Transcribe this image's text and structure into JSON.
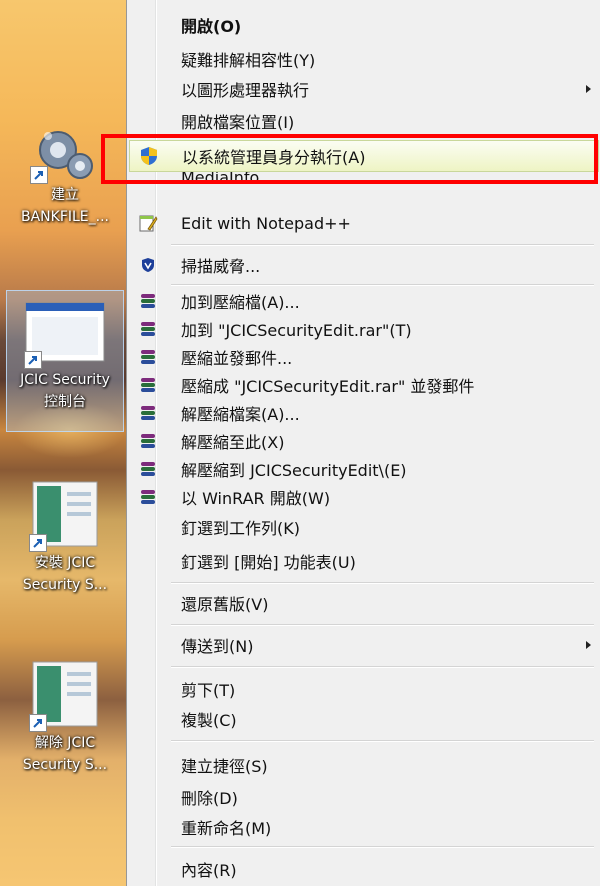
{
  "desktop": {
    "icons": [
      {
        "label": "建立\nBANKFILE_...",
        "icon": "gears-icon"
      },
      {
        "label": "JCIC Security\n控制台",
        "icon": "window-icon"
      },
      {
        "label": "安裝 JCIC\nSecurity S...",
        "icon": "installer-icon"
      },
      {
        "label": "解除 JCIC\nSecurity S...",
        "icon": "installer-icon"
      }
    ]
  },
  "menu": {
    "items": [
      {
        "label": "開啟(O)",
        "bold": true
      },
      {
        "label": "疑難排解相容性(Y)"
      },
      {
        "label": "以圖形處理器執行",
        "submenu": true
      },
      {
        "label": "開啟檔案位置(I)"
      },
      {
        "label": "以系統管理員身分執行(A)",
        "icon": "uac-shield-icon",
        "highlighted": true
      },
      {
        "label": "MediaInfo"
      },
      {
        "label": "Edit with Notepad++",
        "icon": "notepadpp-icon"
      },
      {
        "label": "掃描威脅...",
        "icon": "defender-shield-icon"
      },
      {
        "label": "加到壓縮檔(A)...",
        "icon": "winrar-icon"
      },
      {
        "label": "加到 \"JCICSecurityEdit.rar\"(T)",
        "icon": "winrar-icon"
      },
      {
        "label": "壓縮並發郵件...",
        "icon": "winrar-icon"
      },
      {
        "label": "壓縮成 \"JCICSecurityEdit.rar\" 並發郵件",
        "icon": "winrar-icon"
      },
      {
        "label": "解壓縮檔案(A)...",
        "icon": "winrar-icon"
      },
      {
        "label": "解壓縮至此(X)",
        "icon": "winrar-icon"
      },
      {
        "label": "解壓縮到 JCICSecurityEdit\\(E)",
        "icon": "winrar-icon"
      },
      {
        "label": "以 WinRAR 開啟(W)",
        "icon": "winrar-icon"
      },
      {
        "label": "釘選到工作列(K)"
      },
      {
        "label": "釘選到 [開始] 功能表(U)"
      },
      {
        "label": "還原舊版(V)"
      },
      {
        "label": "傳送到(N)",
        "submenu": true
      },
      {
        "label": "剪下(T)"
      },
      {
        "label": "複製(C)"
      },
      {
        "label": "建立捷徑(S)"
      },
      {
        "label": "刪除(D)"
      },
      {
        "label": "重新命名(M)"
      },
      {
        "label": "內容(R)"
      }
    ]
  },
  "colors": {
    "highlight_box": "#ff0000",
    "menu_bg": "#f0f0f0"
  }
}
